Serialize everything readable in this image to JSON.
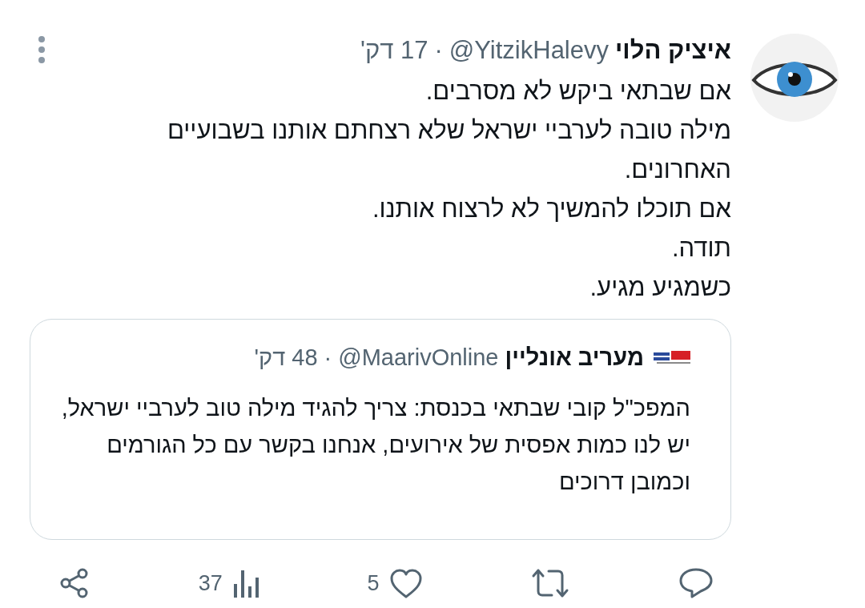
{
  "tweet": {
    "author": {
      "name": "איציק הלוי",
      "handle": "@YitzikHalevy",
      "separator": "·",
      "time": "17 דק'"
    },
    "lines": [
      "אם שבתאי ביקש לא מסרבים.",
      "מילה טובה לערביי ישראל שלא רצחתם אותנו בשבועיים האחרונים.",
      "אם תוכלו להמשיך לא לרצוח אותנו.",
      "תודה.",
      "כשמגיע מגיע."
    ],
    "quote": {
      "author": {
        "name": "מעריב אונליין",
        "handle": "@MaarivOnline",
        "separator": "·",
        "time": "48 דק'"
      },
      "text": "המפכ\"ל קובי שבתאי בכנסת: צריך להגיד מילה טוב לערביי ישראל, יש לנו כמות אפסית של אירועים, אנחנו בקשר עם כל הגורמים וכמובן דרוכים"
    },
    "actions": [
      {
        "kind": "reply"
      },
      {
        "kind": "retweet"
      },
      {
        "kind": "like",
        "count": "5"
      },
      {
        "kind": "views",
        "count": "37"
      },
      {
        "kind": "share"
      }
    ]
  }
}
